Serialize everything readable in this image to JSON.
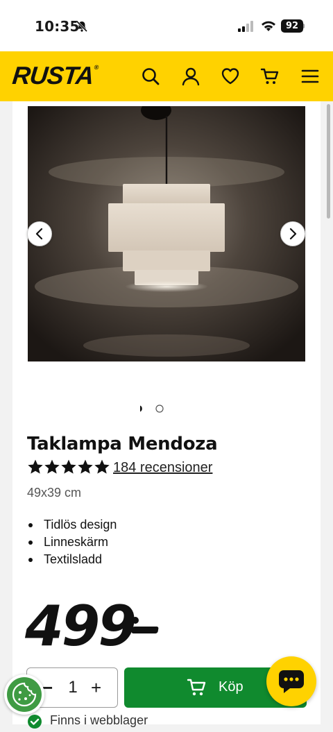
{
  "status_bar": {
    "time": "10:35",
    "battery": "92"
  },
  "header": {
    "logo": "RUSTA",
    "logo_reg": "®"
  },
  "product": {
    "title": "Taklampa Mendoza",
    "rating": 5,
    "rating_max": 5,
    "reviews": "184 recensioner",
    "size": "49x39 cm",
    "features": [
      "Tidlös design",
      "Linneskärm",
      "Textilsladd"
    ],
    "price": "499",
    "image_count": 2,
    "active_image": 1
  },
  "purchase": {
    "quantity": "1",
    "minus": "−",
    "plus": "+",
    "buy_label": "Köp"
  },
  "stock": {
    "label": "Finns i webblager"
  },
  "colors": {
    "brand_yellow": "#ffd200",
    "buy_green": "#108a2e"
  }
}
